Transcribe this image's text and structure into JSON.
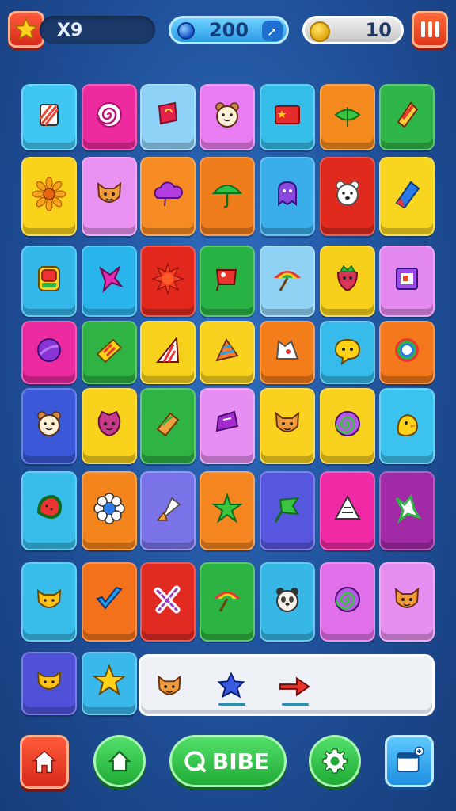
{
  "hud": {
    "level_text": "X9",
    "gems_value": "200",
    "coins_value": "10"
  },
  "play_button_label": "BIBE",
  "board": {
    "rows": [
      [
        {
          "color": "#3fc6f2",
          "icon": "striped-box"
        },
        {
          "color": "#ee2a9f",
          "icon": "swirl"
        },
        {
          "color": "#8fd2f7",
          "icon": "red-flag"
        },
        {
          "color": "#e97cf0",
          "icon": "bear-face"
        },
        {
          "color": "#33bde8",
          "icon": "chinese-flag"
        },
        {
          "color": "#f4891d",
          "icon": "green-leaf"
        },
        {
          "color": "#2fb64a",
          "icon": "red-block"
        }
      ],
      [
        {
          "color": "#f8d21b",
          "icon": "sunflower"
        },
        {
          "color": "#e992f2",
          "icon": "fox-face"
        },
        {
          "color": "#f58b22",
          "icon": "purple-cloud"
        },
        {
          "color": "#f07d1c",
          "icon": "umbrella"
        },
        {
          "color": "#3aaeea",
          "icon": "purple-ghost"
        },
        {
          "color": "#e02a1d",
          "icon": "white-bear"
        },
        {
          "color": "#f8d51e",
          "icon": "blue-crystal"
        }
      ],
      [
        {
          "color": "#33b7ea",
          "icon": "red-card"
        },
        {
          "color": "#29b5ec",
          "icon": "pink-star"
        },
        {
          "color": "#e2281d",
          "icon": "red-sun"
        },
        {
          "color": "#28b243",
          "icon": "red-sign"
        },
        {
          "color": "#8fd2f4",
          "icon": "rainbow-umbrella"
        },
        {
          "color": "#f7d01c",
          "icon": "strawberry"
        },
        {
          "color": "#e388ee",
          "icon": "purple-frame"
        }
      ],
      [
        {
          "color": "#ec2aa0",
          "icon": "purple-ball"
        },
        {
          "color": "#2fb344",
          "icon": "striped-tag"
        },
        {
          "color": "#f7d21c",
          "icon": "striped-triangle"
        },
        {
          "color": "#f8d21f",
          "icon": "cone"
        },
        {
          "color": "#f47d1b",
          "icon": "white-cat"
        },
        {
          "color": "#36bbea",
          "icon": "yellow-bubble"
        },
        {
          "color": "#f4791c",
          "icon": "rainbow-ring"
        }
      ],
      [
        {
          "color": "#3a58d8",
          "icon": "bear-face"
        },
        {
          "color": "#f8d21b",
          "icon": "berry-face"
        },
        {
          "color": "#2fb344",
          "icon": "orange-box"
        },
        {
          "color": "#e78ef2",
          "icon": "purple-box"
        },
        {
          "color": "#f8d21e",
          "icon": "fox-face"
        },
        {
          "color": "#f7d11d",
          "icon": "purple-swirl"
        },
        {
          "color": "#3cc2ef",
          "icon": "yellow-chick"
        }
      ],
      [
        {
          "color": "#38bdea",
          "icon": "watermelon"
        },
        {
          "color": "#f4851d",
          "icon": "white-flower"
        },
        {
          "color": "#7a74e8",
          "icon": "ice-cream"
        },
        {
          "color": "#f48520",
          "icon": "green-star"
        },
        {
          "color": "#5656de",
          "icon": "green-flag"
        },
        {
          "color": "#ef2aa4",
          "icon": "white-triangle"
        },
        {
          "color": "#a12aa6",
          "icon": "green-x"
        }
      ],
      [
        {
          "color": "#38bdea",
          "icon": "yellow-cat"
        },
        {
          "color": "#f4711c",
          "icon": "blue-check"
        },
        {
          "color": "#e02a22",
          "icon": "candy-x"
        },
        {
          "color": "#2db343",
          "icon": "rainbow-umbrella"
        },
        {
          "color": "#36b7e6",
          "icon": "panda-face"
        },
        {
          "color": "#e16fe9",
          "icon": "purple-swirl"
        },
        {
          "color": "#e78ff0",
          "icon": "fox-face"
        }
      ],
      [
        {
          "color": "#4f52d8",
          "icon": "yellow-cat"
        },
        {
          "color": "#3ab8ec",
          "icon": "yellow-star"
        }
      ]
    ]
  },
  "tray": {
    "items": [
      "fox-face",
      "blue-star",
      "red-arrow"
    ]
  },
  "bottom_bar": {
    "buttons": [
      "home-button",
      "home-alt-button",
      "play-button",
      "settings-button",
      "shop-button"
    ]
  }
}
